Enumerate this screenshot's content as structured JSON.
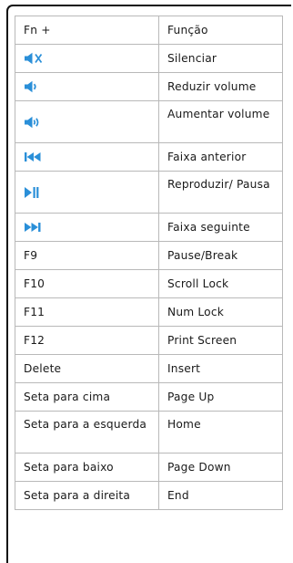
{
  "table": {
    "rows": [
      {
        "left": "Fn +",
        "right": "Função"
      },
      {
        "icon": "mute-icon",
        "right": "Silenciar"
      },
      {
        "icon": "volume-down-icon",
        "right": "Reduzir volume"
      },
      {
        "icon": "volume-up-icon",
        "right": "Aumentar volume"
      },
      {
        "icon": "previous-track-icon",
        "right": "Faixa anterior"
      },
      {
        "icon": "play-pause-icon",
        "right": "Reproduzir/ Pausa"
      },
      {
        "icon": "next-track-icon",
        "right": "Faixa seguinte"
      },
      {
        "left": "F9",
        "right": "Pause/Break"
      },
      {
        "left": "F10",
        "right": "Scroll Lock"
      },
      {
        "left": "F11",
        "right": "Num Lock"
      },
      {
        "left": "F12",
        "right": "Print Screen"
      },
      {
        "left": "Delete",
        "right": "Insert"
      },
      {
        "left": "Seta para cima",
        "right": "Page Up"
      },
      {
        "left": "Seta para a esquerda",
        "right": "Home"
      },
      {
        "left": "Seta para baixo",
        "right": "Page Down"
      },
      {
        "left": "Seta para a direita",
        "right": "End"
      }
    ]
  },
  "colors": {
    "icon": "#2a8fd8",
    "border": "#b9b9b9",
    "frame": "#111111"
  }
}
